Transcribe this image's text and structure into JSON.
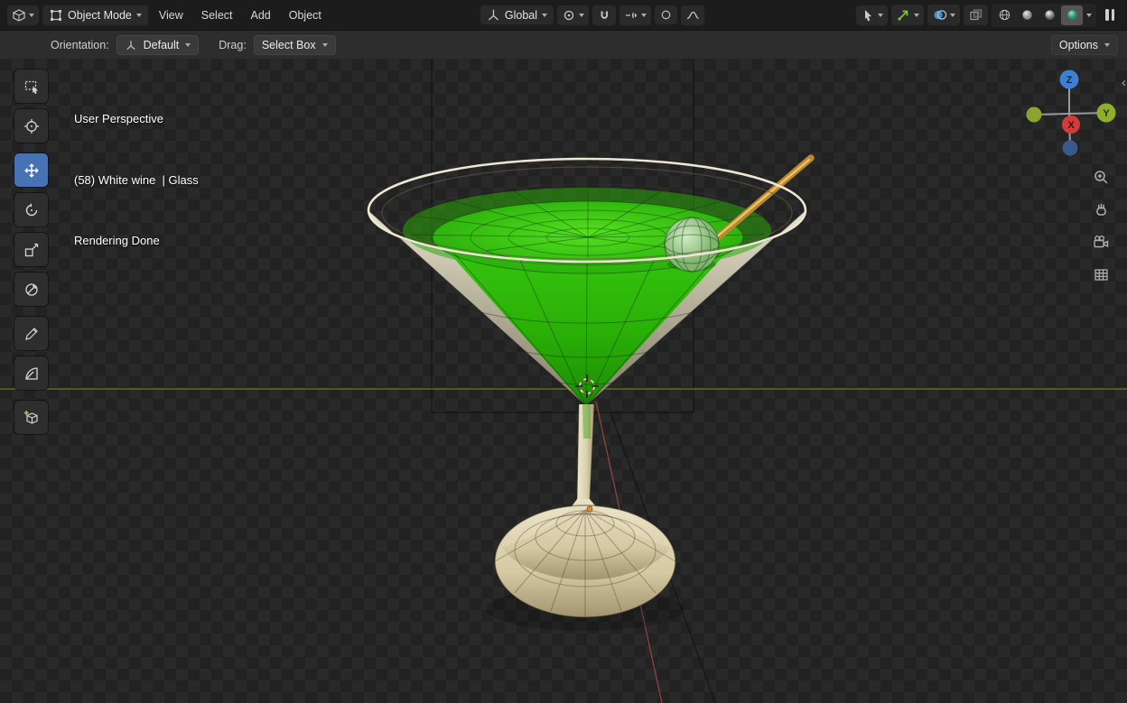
{
  "topbar": {
    "editor_icon": "3d-viewport-editor",
    "mode_label": "Object Mode",
    "menus": [
      "View",
      "Select",
      "Add",
      "Object"
    ],
    "orientation_label": "Global",
    "left_icons": [
      "transform-orientation",
      "pivot-point",
      "snap-magnet",
      "snap-target",
      "proportional-editing",
      "proportional-falloff"
    ],
    "right_icons": [
      "mouse-select",
      "gizmo",
      "overlays",
      "xray",
      "shading-wireframe",
      "shading-solid",
      "shading-material",
      "shading-rendered",
      "pause-bars"
    ],
    "active_shading": "rendered"
  },
  "tool_header": {
    "orientation_field_label": "Orientation:",
    "orientation_value": "Default",
    "drag_label": "Drag:",
    "drag_value": "Select Box",
    "options_label": "Options"
  },
  "toolbar": {
    "tools": [
      "select-box",
      "cursor",
      "move",
      "rotate",
      "scale",
      "transform",
      "annotate",
      "measure",
      "add-cube"
    ],
    "active_tool": "move"
  },
  "viewport": {
    "overlay": {
      "line1": "User Perspective",
      "line2": "(58) White wine  | Glass",
      "line3": "Rendering Done"
    },
    "gizmo": {
      "z": "Z",
      "y": "Y",
      "x": "X"
    },
    "nav_icons": [
      "zoom",
      "pan-hand",
      "camera-view",
      "orthographic-grid"
    ]
  },
  "colors": {
    "accent_blue": "#4772b3",
    "liquid_green": "#3fd013",
    "glass_cream": "#e9e3cd",
    "stick_gold": "#c9973c",
    "axis_x_red": "#d13b3b",
    "axis_y_green": "#8fae2c",
    "axis_z_blue": "#3d7fd0"
  }
}
